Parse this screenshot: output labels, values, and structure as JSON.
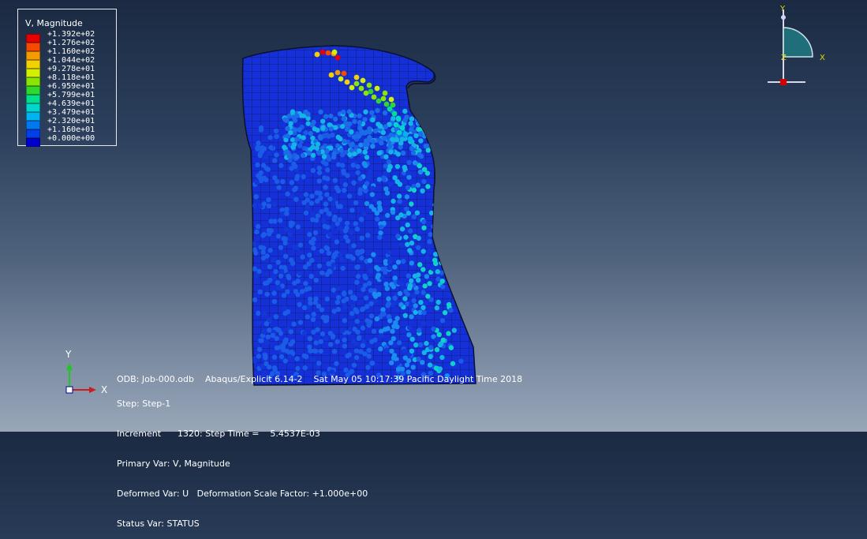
{
  "legend": {
    "title": "V, Magnitude",
    "entries": [
      {
        "value": "+1.392e+02",
        "color": "#e60000"
      },
      {
        "value": "+1.276e+02",
        "color": "#f54a00"
      },
      {
        "value": "+1.160e+02",
        "color": "#f59b00"
      },
      {
        "value": "+1.044e+02",
        "color": "#f5d000"
      },
      {
        "value": "+9.278e+01",
        "color": "#d2f000"
      },
      {
        "value": "+8.118e+01",
        "color": "#8ae600"
      },
      {
        "value": "+6.959e+01",
        "color": "#2fd82f"
      },
      {
        "value": "+5.799e+01",
        "color": "#00e08a"
      },
      {
        "value": "+4.639e+01",
        "color": "#00d6cc"
      },
      {
        "value": "+3.479e+01",
        "color": "#00b4f0"
      },
      {
        "value": "+2.320e+01",
        "color": "#0078f0"
      },
      {
        "value": "+1.160e+01",
        "color": "#0040e8"
      },
      {
        "value": "+0.000e+00",
        "color": "#0000cc"
      }
    ]
  },
  "triad_view": {
    "y": "Y",
    "z": "Z",
    "x": "X"
  },
  "triad_axes": {
    "y": "Y",
    "x": "X"
  },
  "odb_line": "ODB: Job-000.odb    Abaqus/Explicit 6.14-2    Sat May 05 10:17:39 Pacific Daylight Time 2018",
  "status": [
    "Step: Step-1",
    "Increment      1320: Step Time =    5.4537E-03",
    "Primary Var: V, Magnitude",
    "Deformed Var: U   Deformation Scale Factor: +1.000e+00",
    "Status Var: STATUS"
  ],
  "colors": {
    "mesh_edge": "#0a1a55",
    "part_fill": "#1530d8",
    "particle_low": "#1a5ce8"
  }
}
